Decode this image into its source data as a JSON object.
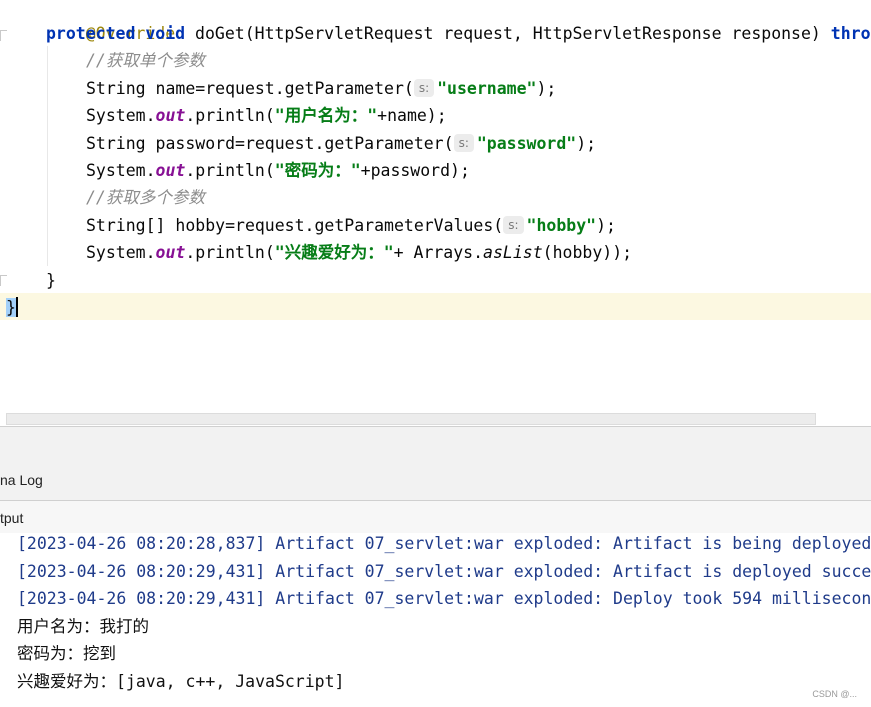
{
  "editor": {
    "annotation": "@Override",
    "sig_protected": "protected",
    "sig_void": "void",
    "sig_rest": " doGet(HttpServletRequest request, HttpServletResponse response) ",
    "sig_throws": "thro",
    "comment1": "//获取单个参数",
    "l3_a": "String name=request.getParameter(",
    "hint_s": "s:",
    "str_username": "\"username\"",
    "tail_semicolon": ");",
    "sys": "System.",
    "out": "out",
    "println": ".println(",
    "str_user_label": "\"用户名为：\"",
    "l4_tail": "+name);",
    "l5_a": "String password=request.getParameter(",
    "str_password": "\"password\"",
    "str_pwd_label": "\"密码为：\"",
    "l6_tail": "+password);",
    "comment2": "//获取多个参数",
    "l8_a": "String[] hobby=request.getParameterValues(",
    "str_hobby": "\"hobby\"",
    "str_hobby_label": "\"兴趣爱好为：\"",
    "l9_mid": "+ Arrays.",
    "aslist": "asList",
    "l9_tail": "(hobby));",
    "close_method": "}",
    "close_class": "}"
  },
  "panels": {
    "log_tab": "na Log",
    "output_tab": "tput"
  },
  "console": {
    "lines": [
      "[2023-04-26 08:20:28,837] Artifact 07_servlet:war exploded: Artifact is being deployed",
      "[2023-04-26 08:20:29,431] Artifact 07_servlet:war exploded: Artifact is deployed succe",
      "[2023-04-26 08:20:29,431] Artifact 07_servlet:war exploded: Deploy took 594 millisecon",
      "用户名为：我打的",
      "密码为：挖到",
      "兴趣爱好为：[java, c++, JavaScript]"
    ]
  },
  "watermark": "CSDN @..."
}
